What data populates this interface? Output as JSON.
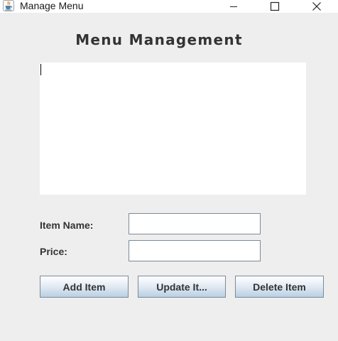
{
  "window": {
    "title": "Manage Menu",
    "icon": "java-cup-icon"
  },
  "heading": "Menu Management",
  "menu_list": {
    "content": ""
  },
  "form": {
    "item_name_label": "Item Name:",
    "item_name_value": "",
    "price_label": "Price:",
    "price_value": ""
  },
  "buttons": {
    "add": "Add Item",
    "update": "Update It...",
    "delete": "Delete Item"
  },
  "colors": {
    "window_bg": "#eeeeee",
    "button_gradient_bottom": "#b8cfe5",
    "text": "#333333"
  }
}
